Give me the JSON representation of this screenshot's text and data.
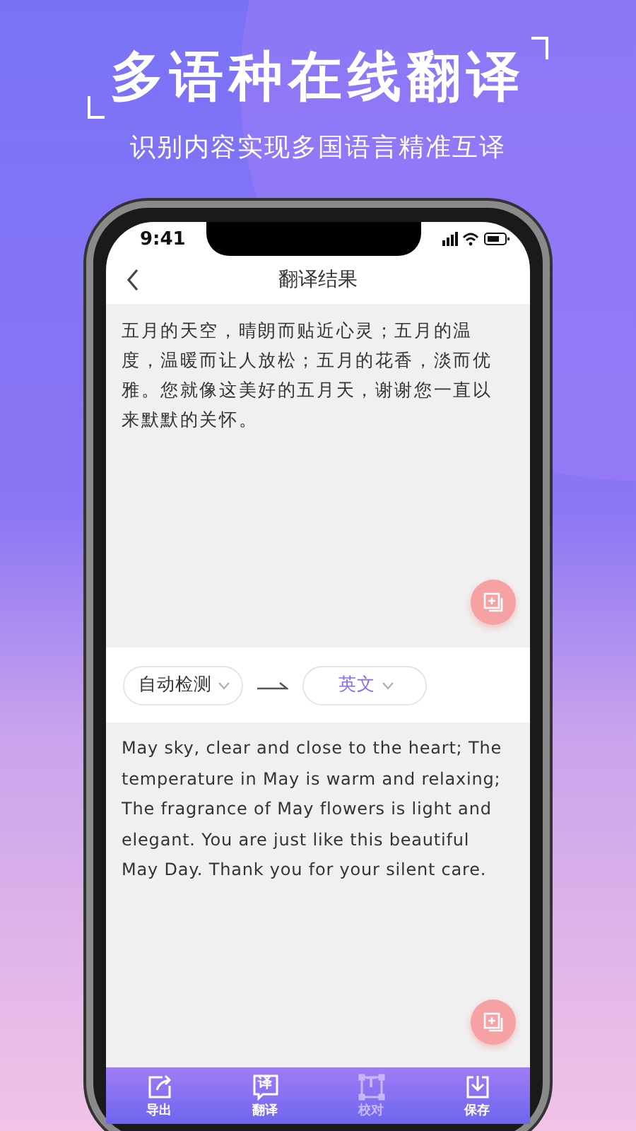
{
  "headline": "多语种在线翻译",
  "subheadline": "识别内容实现多国语言精准互译",
  "status_bar": {
    "time": "9:41"
  },
  "nav": {
    "title": "翻译结果"
  },
  "source_text": "五月的天空，晴朗而贴近心灵；五月的温度，温暖而让人放松；五月的花香，淡而优雅。您就像这美好的五月天，谢谢您一直以来默默的关怀。",
  "languages": {
    "from": "自动检测",
    "to": "英文"
  },
  "target_text": "May sky, clear and close to the heart; The temperature in May is warm and relaxing; The fragrance of May flowers is light and elegant. You are just like this beautiful May Day. Thank you for your silent care.",
  "tab_bar": [
    {
      "kind": "export",
      "label": "导出",
      "dimmed": false
    },
    {
      "kind": "translate",
      "label": "翻译",
      "glyph": "译",
      "dimmed": false
    },
    {
      "kind": "proofread",
      "label": "校对",
      "glyph": "T",
      "dimmed": true
    },
    {
      "kind": "save",
      "label": "保存",
      "dimmed": false
    }
  ]
}
